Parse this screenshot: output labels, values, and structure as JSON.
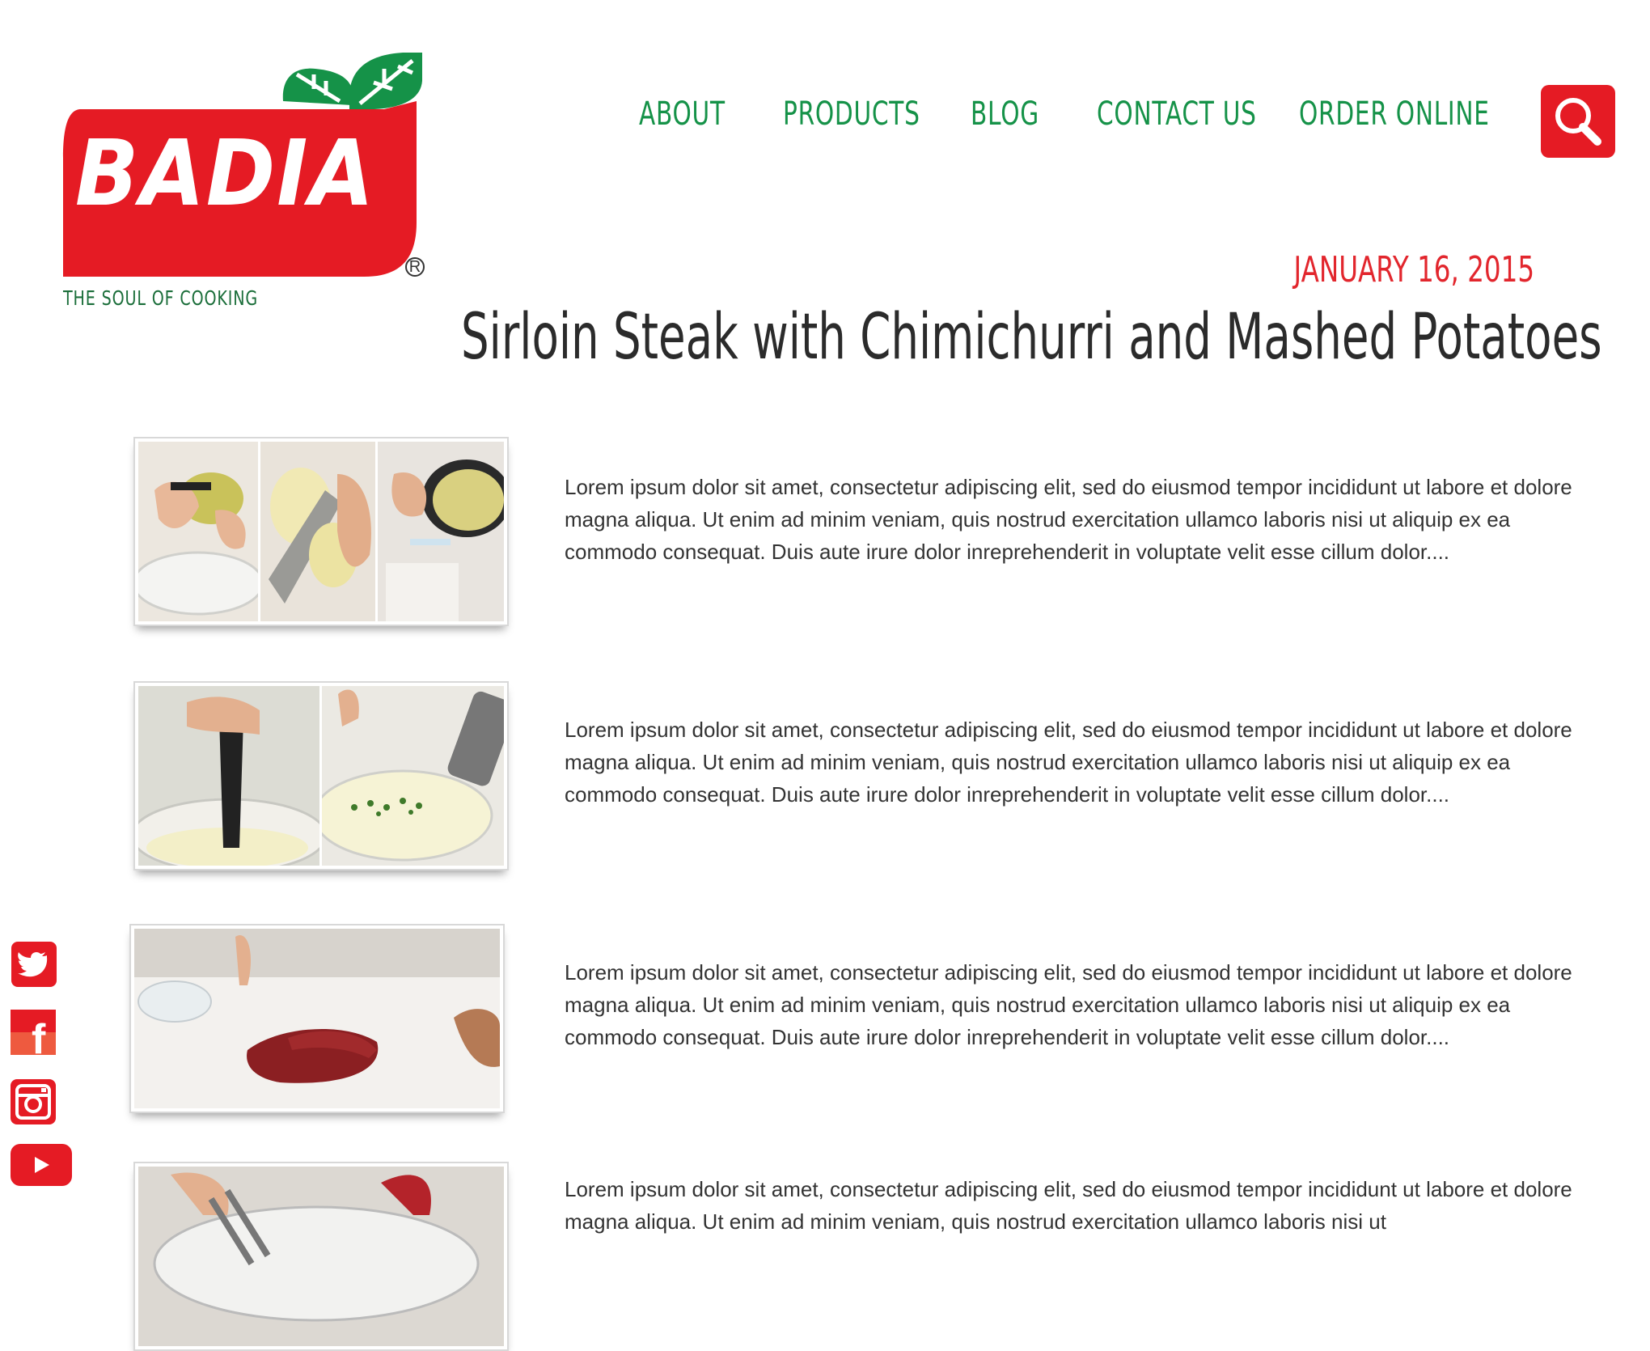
{
  "brand": {
    "name": "BADIA",
    "tagline": "THE SOUL OF COOKING",
    "registered": "R",
    "red": "#e51b24",
    "green": "#159248"
  },
  "nav": {
    "items": [
      "ABOUT",
      "PRODUCTS",
      "BLOG",
      "CONTACT US",
      "ORDER ONLINE"
    ],
    "search_icon": "search-icon"
  },
  "post": {
    "date": "JANUARY 16, 2015",
    "title": "Sirloin Steak with Chimichurri and Mashed Potatoes",
    "steps": [
      {
        "text": "Lorem ipsum dolor sit amet, consectetur adipiscing elit, sed do eiusmod tempor incididunt ut labore et dolore magna aliqua. Ut enim ad minim veniam, quis nostrud exercitation ullamco laboris nisi ut aliquip ex ea commodo consequat. Duis aute irure dolor inreprehenderit in voluptate velit esse cillum dolor...."
      },
      {
        "text": "Lorem ipsum dolor sit amet, consectetur adipiscing elit, sed do eiusmod tempor incididunt ut labore et dolore magna aliqua. Ut enim ad minim veniam, quis nostrud exercitation ullamco laboris nisi ut aliquip ex ea commodo consequat. Duis aute irure dolor inreprehenderit in voluptate velit esse cillum dolor...."
      },
      {
        "text": "Lorem ipsum dolor sit amet, consectetur adipiscing elit, sed do eiusmod tempor incididunt ut labore et dolore magna aliqua. Ut enim ad minim veniam, quis nostrud exercitation ullamco laboris nisi ut aliquip ex ea commodo consequat. Duis aute irure dolor inreprehenderit in voluptate velit esse cillum dolor...."
      },
      {
        "text": "Lorem ipsum dolor sit amet, consectetur adipiscing elit, sed do eiusmod tempor incididunt ut labore et dolore magna aliqua. Ut enim ad minim veniam, quis nostrud exercitation ullamco laboris nisi ut"
      }
    ]
  },
  "social": {
    "icons": [
      "twitter-icon",
      "facebook-icon",
      "instagram-icon",
      "youtube-icon"
    ],
    "facebook_glyph": "f"
  }
}
